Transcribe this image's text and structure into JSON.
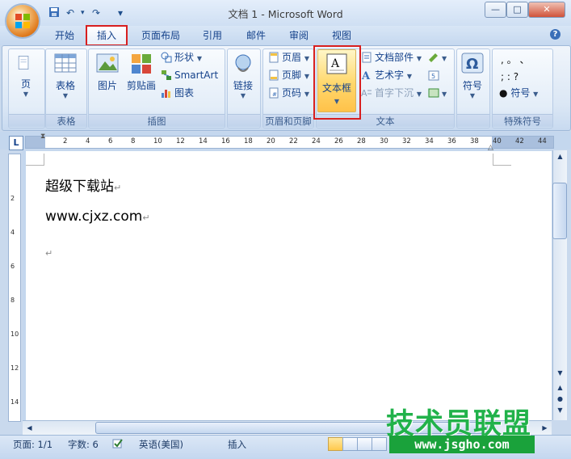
{
  "window": {
    "title": "文档 1 - Microsoft Word",
    "controls": {
      "minimize": "—",
      "maximize": "□",
      "close": "✕"
    }
  },
  "quick_access": {
    "save": "save-icon",
    "undo": "↶",
    "redo": "↷",
    "more": "▾"
  },
  "tabs": [
    {
      "label": "开始",
      "active": false
    },
    {
      "label": "插入",
      "active": true
    },
    {
      "label": "页面布局",
      "active": false
    },
    {
      "label": "引用",
      "active": false
    },
    {
      "label": "邮件",
      "active": false
    },
    {
      "label": "审阅",
      "active": false
    },
    {
      "label": "视图",
      "active": false
    }
  ],
  "help": "?",
  "ribbon": {
    "groups": {
      "pages": {
        "label": "",
        "button": "页"
      },
      "tables": {
        "label": "表格",
        "button": "表格"
      },
      "illustrations": {
        "label": "插图",
        "picture": "图片",
        "clipart": "剪贴画",
        "shapes": "形状",
        "smartart": "SmartArt",
        "chart": "图表"
      },
      "links": {
        "label": "",
        "button": "链接"
      },
      "header_footer": {
        "label": "页眉和页脚",
        "header": "页眉",
        "footer": "页脚",
        "page_number": "页码"
      },
      "text": {
        "label": "文本",
        "textbox": "文本框",
        "quick_parts": "文档部件",
        "wordart": "艺术字",
        "dropcap": "首字下沉"
      },
      "symbols": {
        "label": "",
        "button": "符号"
      },
      "special": {
        "label": "特殊符号",
        "symbol": "符号",
        "row1": ",  。  、",
        "row2": ";  :  ?"
      }
    }
  },
  "ruler": {
    "tab_selector": "L",
    "ticks": [
      "2",
      "4",
      "6",
      "8",
      "10",
      "12",
      "14",
      "16",
      "18",
      "20",
      "22",
      "24",
      "26",
      "28",
      "30",
      "32",
      "34",
      "36",
      "38",
      "40",
      "42",
      "44"
    ],
    "vticks": [
      "2",
      "4",
      "6",
      "8",
      "10",
      "12",
      "14"
    ]
  },
  "document": {
    "lines": [
      "超级下载站",
      "www.cjxz.com",
      ""
    ],
    "para_mark": "↵"
  },
  "status": {
    "page": "页面: 1/1",
    "words": "字数: 6",
    "language": "英语(美国)",
    "mode": "插入"
  },
  "watermark": {
    "title": "技术员联盟",
    "url": "www.jsgho.com"
  }
}
